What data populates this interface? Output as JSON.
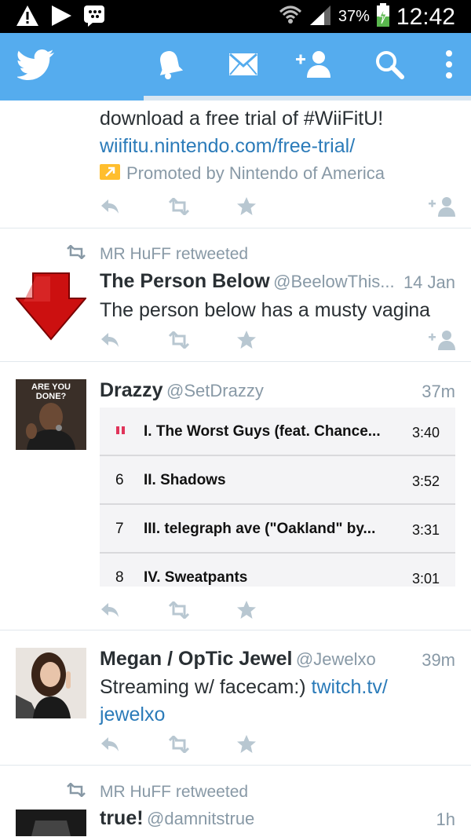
{
  "status_bar": {
    "battery_pct": "37%",
    "time": "12:42",
    "left_icons": [
      "warning-icon",
      "play-icon",
      "bbm-icon"
    ],
    "right_icons": [
      "wifi-icon",
      "signal-icon",
      "battery-charging-icon"
    ]
  },
  "app_bar": {
    "icons": [
      "twitter-bird-icon",
      "notifications-bell-icon",
      "messages-envelope-icon",
      "add-user-icon",
      "search-icon",
      "overflow-menu-icon"
    ],
    "progress_fraction": 0.305
  },
  "colors": {
    "twitter_blue": "#55acee",
    "link": "#2b7bb9",
    "meta_gray": "#8899a6",
    "action_gray": "#b8c7d1",
    "promoted_yellow": "#ffbe2e",
    "red_arrow": "#cc1010"
  },
  "tweets": [
    {
      "text_line": "download a free trial of #WiiFitU!",
      "link": "wiifitu.nintendo.com/free-trial/",
      "promoted_label": "Promoted by Nintendo of America"
    },
    {
      "retweeted_by": "MR HuFF retweeted",
      "name": "The Person Below",
      "handle": "@BeelowThis...",
      "time": "14 Jan",
      "text": "The person below has a musty vagina"
    },
    {
      "name": "Drazzy",
      "handle": "@SetDrazzy",
      "time": "37m",
      "avatar_caption": "ARE YOU DONE?",
      "tracks": [
        {
          "num": "",
          "title": "I. The Worst Guys (feat. Chance...",
          "duration": "3:40",
          "playing": true
        },
        {
          "num": "6",
          "title": "II. Shadows",
          "duration": "3:52"
        },
        {
          "num": "7",
          "title": "III. telegraph ave (\"Oakland\" by...",
          "duration": "3:31"
        },
        {
          "num": "8",
          "title": "IV. Sweatpants",
          "duration": "3:01"
        }
      ]
    },
    {
      "name": "Megan / OpTic Jewel",
      "handle": "@Jewelxo",
      "time": "39m",
      "text": "Streaming w/ facecam:) ",
      "link_line1": "twitch.tv/",
      "link_line2": "jewelxo"
    },
    {
      "retweeted_by": "MR HuFF retweeted",
      "name": "true!",
      "handle": "@damnitstrue",
      "time": "1h"
    }
  ]
}
